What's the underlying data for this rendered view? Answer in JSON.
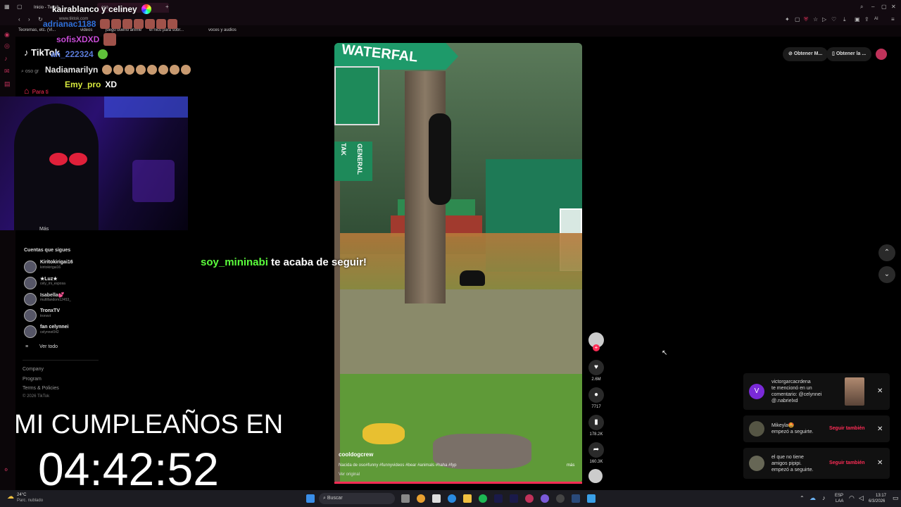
{
  "browser": {
    "tabs": [
      {
        "label": "Inicio - Twitch"
      },
      {
        "label": "oso"
      }
    ],
    "new_tab": "+",
    "url": "www.tiktok.com",
    "bookmarks": [
      {
        "label": "Teoremas, etc. (Vi..."
      },
      {
        "label": "videos"
      },
      {
        "label": "juego bueno anime"
      },
      {
        "label": "el nico para sobr..."
      },
      {
        "label": "voces y audios"
      }
    ],
    "toolbar_ai": "AI"
  },
  "chat": [
    {
      "name": "kairablanco y celiney",
      "color": "#ffffff",
      "message": ""
    },
    {
      "name": "adrianac1188",
      "color": "#2e6fd8",
      "message": ""
    },
    {
      "name": "sofisXDXD",
      "color": "#c84bd6",
      "message": ""
    },
    {
      "name": "ah_222324",
      "color": "#5a7bd8",
      "message": ""
    },
    {
      "name": "Nadiamarilyn",
      "color": "#e8e8e8",
      "message": ""
    },
    {
      "name": "Emy_pro",
      "color": "#d7e93d",
      "message": "XD"
    }
  ],
  "tiktok": {
    "logo": "TikTok",
    "search_placeholder": "oso gr",
    "for_you": "Para ti",
    "more": "Más",
    "following_title": "Cuentas que sigues",
    "following": [
      {
        "name": "Kiritokirigai16",
        "handle": "kiritokirigai16"
      },
      {
        "name": "★Luz★",
        "handle": "cely_mi_esposa"
      },
      {
        "name": "Isabella💕",
        "handle": "multifandom12453_"
      },
      {
        "name": "TronxTV",
        "handle": "tronxvt"
      },
      {
        "name": "fan celynnei",
        "handle": "celynnei042"
      }
    ],
    "see_all": "Ver todo",
    "footer": [
      "Company",
      "Program",
      "Terms & Policies",
      "© 2026 TikTok"
    ]
  },
  "overlay": {
    "birthday": "MI CUMPLEAÑOS EN",
    "countdown": "04:42:52",
    "follow_user": "soy_mininabi",
    "follow_text": "te acaba de seguir!"
  },
  "video": {
    "sign1": "WATERFAL",
    "sign2": "TAK",
    "sign3": "GENERAL",
    "author": "cooldogcrew",
    "caption": "Nacida de oso#funny #funnyvideos #bear #animals #haha #fyp",
    "more": "más",
    "sound": "Ver original",
    "likes": "2.6M",
    "comments": "7717",
    "saves": "178.2K",
    "shares": "160.3K"
  },
  "top_right": {
    "btn1": "Obtener M...",
    "btn2": "Obtener la ..."
  },
  "notifications": [
    {
      "user": "victorgarcacrdena",
      "text1": "te mencionó en un",
      "text2": "comentario: @celynnei",
      "text3": "@.nabrielxd",
      "avatar_letter": "V",
      "follow": ""
    },
    {
      "user": "Mikeyla🤩",
      "text1": "empezó a seguirte.",
      "text2": "",
      "text3": "",
      "avatar_letter": "",
      "follow": "Seguir también"
    },
    {
      "user": "el que no tiene",
      "text1": "amigos pipipi.",
      "text2": "empezó a seguirte.",
      "text3": "",
      "avatar_letter": "",
      "follow": "Seguir también"
    }
  ],
  "close_glyph": "✕",
  "taskbar": {
    "weather_temp": "24°C",
    "weather_desc": "Parc. nublado",
    "search": "Buscar",
    "lang1": "ESP",
    "lang2": "LAA",
    "time": "13:17",
    "date": "6/3/2026"
  },
  "colors": {
    "accent": "#fe2c55",
    "follow_green": "#5bff3c"
  }
}
